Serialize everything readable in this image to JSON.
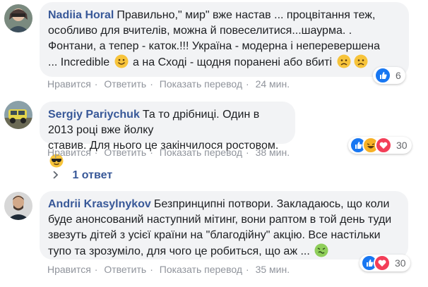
{
  "comments": [
    {
      "author": "Nadiia Horal",
      "text_lines": [
        "Правильно,\" мир\" вже настав ... процвітання теж,",
        "особливо для вчителів, можна й повеселитися...шаурма. .",
        "Фонтани, а тепер - каток.!!! Україна - модерна і неперевершена",
        "... Incredible",
        " а на Сході - щодня поранені або вбиті "
      ],
      "actions": [
        "Нравится",
        "Ответить",
        "Показать перевод"
      ],
      "time": "24 мин.",
      "reaction_count": "6"
    },
    {
      "author": "Sergiy Pariychuk",
      "text_lines": [
        "Та то дрібниці. Один в 2013 році вже йолку",
        "ставив. Для нього це закінчилося ростовом."
      ],
      "actions": [
        "Нравится",
        "Ответить",
        "Показать перевод"
      ],
      "time": "38 мин.",
      "reaction_count": "30",
      "replies_label": "1 ответ"
    },
    {
      "author": "Andrii Krasylnykov",
      "text_lines": [
        "Безпринципні потвори. Закладаюсь, що коли",
        "буде анонсований наступний мітинг, вони раптом в той день туди",
        "звезуть дітей з усієї країни на \"благодійну\" акцію. Все настільки",
        "тупо та зрозуміло, для чого це робиться, що аж ..."
      ],
      "actions": [
        "Нравится",
        "Ответить",
        "Показать перевод"
      ],
      "time": "35 мин.",
      "reaction_count": "30"
    }
  ],
  "colors": {
    "author": "#385898",
    "bubble": "#f2f3f5",
    "meta": "#90949c"
  }
}
